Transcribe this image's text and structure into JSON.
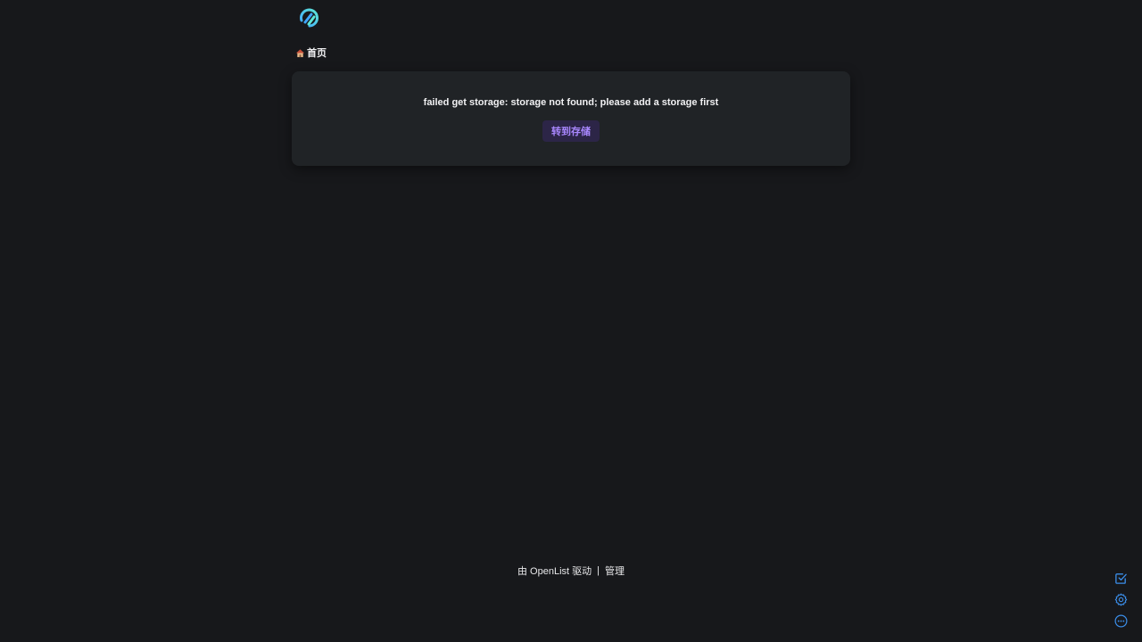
{
  "header": {
    "logo_icon": "openlist-logo-icon"
  },
  "breadcrumb": {
    "home_icon": "home-icon",
    "home_label": "首页"
  },
  "error_card": {
    "message": "failed get storage: storage not found; please add a storage first",
    "button_label": "转到存储"
  },
  "footer": {
    "powered_prefix": "由 ",
    "powered_name": "OpenList",
    "powered_suffix": " 驱动",
    "separator": "|",
    "manage_label": "管理"
  },
  "side_tools": {
    "items": [
      "checkbox-icon",
      "gear-icon",
      "more-icon"
    ]
  },
  "colors": {
    "background": "#17181b",
    "card": "#202326",
    "accent": "#a987ff",
    "button_bg": "#2c2547",
    "tool_icon": "#3b8eea"
  }
}
